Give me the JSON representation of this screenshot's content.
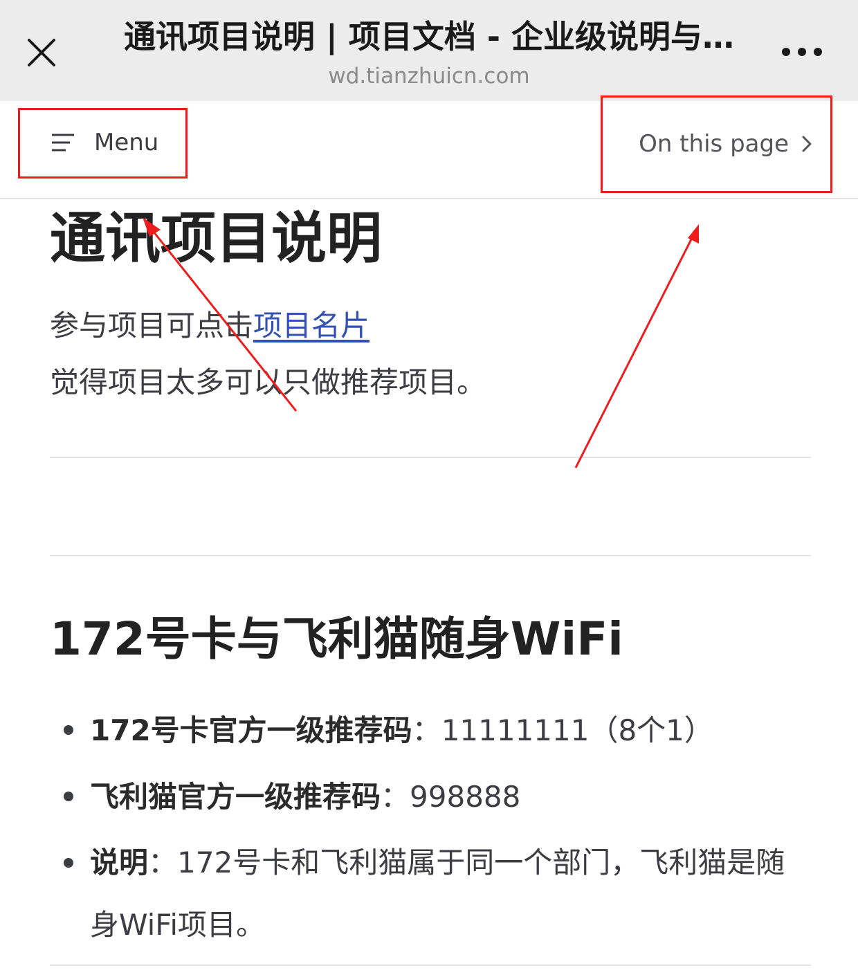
{
  "browser": {
    "title": "通讯项目说明 | 项目文档 - 企业级说明与…",
    "domain": "wd.tianzhuicn.com",
    "close_icon": "close-icon",
    "more_icon": "more-horizontal-icon"
  },
  "nav": {
    "menu_label": "Menu",
    "toc_label": "On this page"
  },
  "annotation_color": "#ee1c1c",
  "link_color": "#3451b2",
  "content": {
    "title": "通讯项目说明",
    "intro_prefix": "参与项目可点击",
    "intro_link": "项目名片",
    "intro_line2": "觉得项目太多可以只做推荐项目。",
    "section_title": "172号卡与飞利猫随身WiFi",
    "items": [
      {
        "label": "172号卡官方一级推荐码",
        "sep": "：",
        "value": "11111111（8个1）"
      },
      {
        "label": "飞利猫官方一级推荐码",
        "sep": "：",
        "value": "998888"
      },
      {
        "label": "说明",
        "sep": "：",
        "value": "172号卡和飞利猫属于同一个部门，飞利猫是随身WiFi项目。"
      }
    ]
  }
}
